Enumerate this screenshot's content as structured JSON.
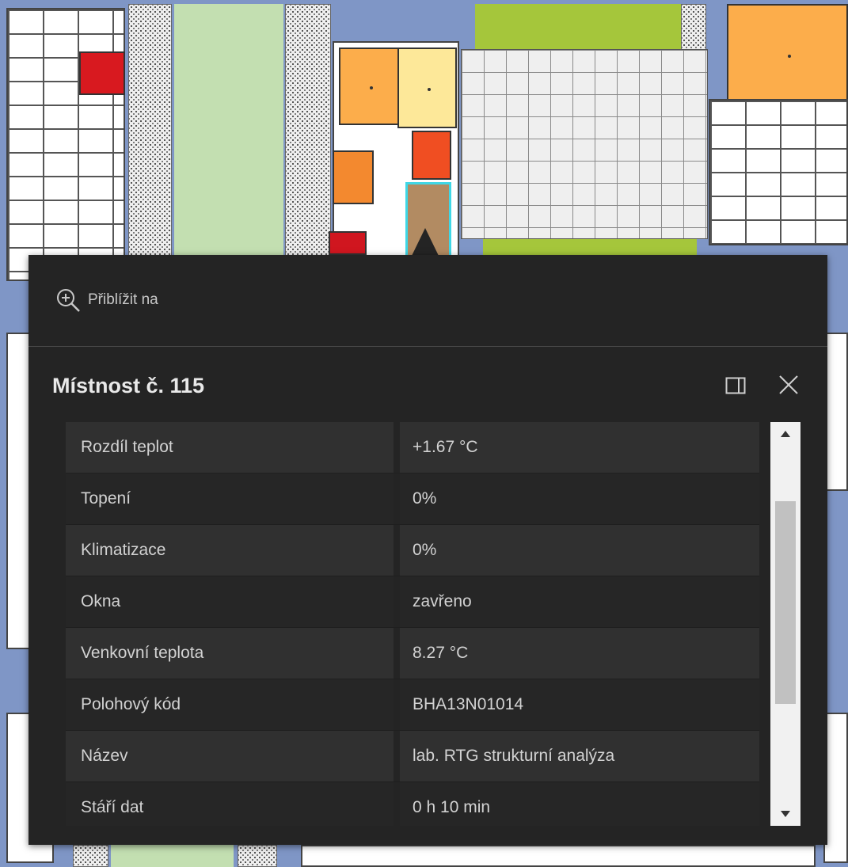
{
  "popup": {
    "zoom_label": "Přiblížit na",
    "title": "Místnost č. 115",
    "rows": [
      {
        "key": "Rozdíl teplot",
        "value": "+1.67 °C"
      },
      {
        "key": "Topení",
        "value": "0%"
      },
      {
        "key": "Klimatizace",
        "value": "0%"
      },
      {
        "key": "Okna",
        "value": "zavřeno"
      },
      {
        "key": "Venkovní teplota",
        "value": "8.27 °C"
      },
      {
        "key": "Polohový kód",
        "value": "BHA13N01014"
      },
      {
        "key": "Název",
        "value": "lab. RTG strukturní analýza"
      },
      {
        "key": "Stáří dat",
        "value": "0 h 10 min"
      }
    ],
    "icons": {
      "zoom": "zoom-in-icon",
      "dock": "dock-icon",
      "close": "close-icon",
      "scroll_up": "scroll-up-arrow-icon",
      "scroll_down": "scroll-down-arrow-icon"
    }
  },
  "colors": {
    "popup_bg": "#242424",
    "row_light": "#303030",
    "row_dark": "#262626",
    "text": "#d2d2d2",
    "selected_room_outline": "#3fd7e6",
    "selected_room_fill": "#b28b62"
  }
}
